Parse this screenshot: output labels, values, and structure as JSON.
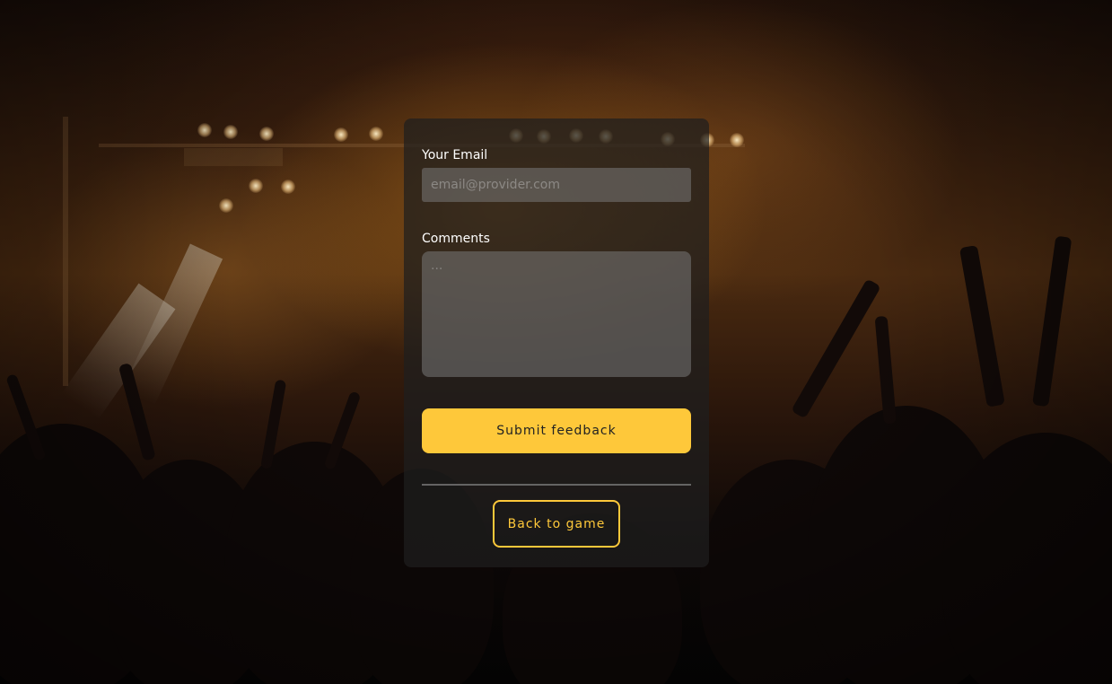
{
  "background": {
    "scene": "concert-crowd-stage-lights",
    "accent_color": "#fec83a"
  },
  "form": {
    "email": {
      "label": "Your Email",
      "placeholder": "email@provider.com",
      "value": ""
    },
    "comments": {
      "label": "Comments",
      "placeholder": "...",
      "value": ""
    },
    "submit_label": "Submit feedback",
    "back_label": "Back to game"
  }
}
